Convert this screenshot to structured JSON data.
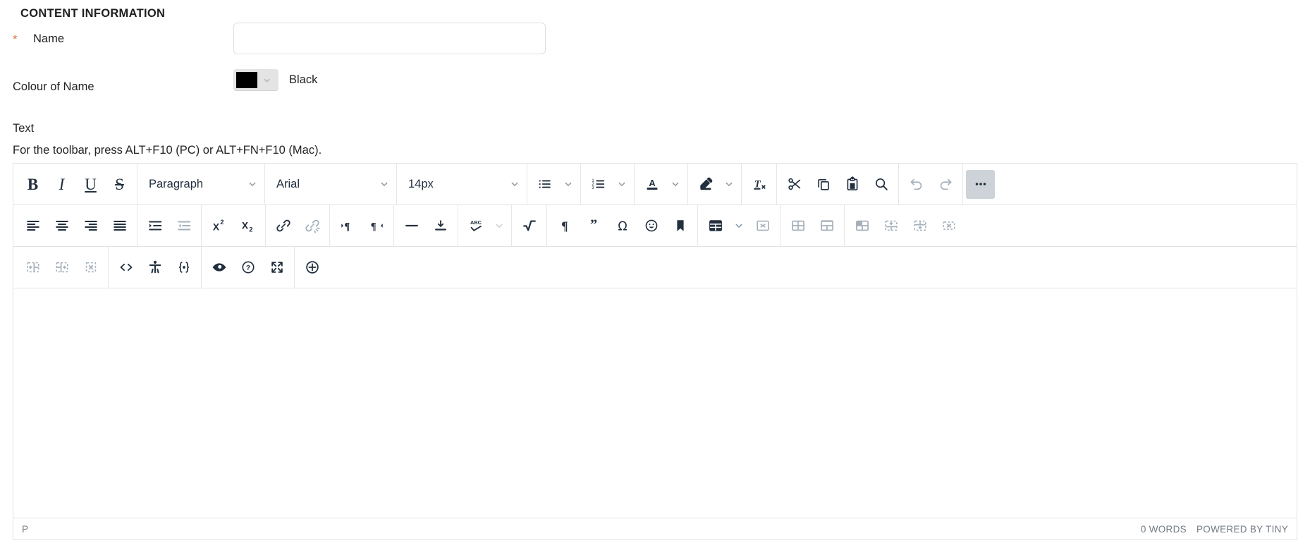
{
  "form": {
    "section_title": "CONTENT INFORMATION",
    "name_field": {
      "label": "Name",
      "required_marker": "*",
      "value": "",
      "placeholder": ""
    },
    "colour_field": {
      "label": "Colour of Name",
      "selected_colour_name": "Black",
      "selected_colour_hex": "#000000",
      "chevron_icon": "chevron-down-icon"
    },
    "text_field": {
      "label": "Text",
      "hint": "For the toolbar, press ALT+F10 (PC) or ALT+FN+F10 (Mac)."
    }
  },
  "editor": {
    "toolbar_rows": [
      {
        "groups": [
          {
            "items": [
              {
                "name": "bold-button",
                "icon": "bold-icon",
                "label": "B",
                "disabled": false
              },
              {
                "name": "italic-button",
                "icon": "italic-icon",
                "label": "I",
                "disabled": false
              },
              {
                "name": "underline-button",
                "icon": "underline-icon",
                "label": "U",
                "disabled": false
              },
              {
                "name": "strikethrough-button",
                "icon": "strikethrough-icon",
                "label": "S",
                "disabled": false
              }
            ]
          },
          {
            "items": [
              {
                "name": "block-format-select",
                "icon": "chevron-down-icon",
                "label": "Paragraph",
                "type": "select",
                "width": "para"
              }
            ]
          },
          {
            "items": [
              {
                "name": "font-family-select",
                "icon": "chevron-down-icon",
                "label": "Arial",
                "type": "select",
                "width": "font"
              }
            ]
          },
          {
            "items": [
              {
                "name": "font-size-select",
                "icon": "chevron-down-icon",
                "label": "14px",
                "type": "select",
                "width": "size"
              }
            ]
          },
          {
            "items": [
              {
                "name": "bullet-list-button",
                "icon": "bullet-list-icon",
                "label": "",
                "split": true
              }
            ]
          },
          {
            "items": [
              {
                "name": "numbered-list-button",
                "icon": "numbered-list-icon",
                "label": "",
                "split": true
              }
            ]
          },
          {
            "items": [
              {
                "name": "text-colour-button",
                "icon": "text-colour-icon",
                "label": "A",
                "split": true
              }
            ]
          },
          {
            "items": [
              {
                "name": "highlight-colour-button",
                "icon": "highlighter-icon",
                "label": "",
                "split": true
              }
            ]
          },
          {
            "items": [
              {
                "name": "remove-format-button",
                "icon": "remove-format-icon",
                "label": "",
                "disabled": false
              }
            ]
          },
          {
            "items": [
              {
                "name": "cut-button",
                "icon": "scissors-icon",
                "label": "",
                "disabled": false
              },
              {
                "name": "copy-button",
                "icon": "copy-icon",
                "label": "",
                "disabled": false
              },
              {
                "name": "paste-button",
                "icon": "clipboard-icon",
                "label": "",
                "disabled": false
              },
              {
                "name": "search-replace-button",
                "icon": "search-icon",
                "label": "",
                "disabled": false
              }
            ]
          },
          {
            "items": [
              {
                "name": "undo-button",
                "icon": "undo-icon",
                "label": "",
                "disabled": true
              },
              {
                "name": "redo-button",
                "icon": "redo-icon",
                "label": "",
                "disabled": true
              }
            ]
          },
          {
            "items": [
              {
                "name": "more-toolbar-button",
                "icon": "ellipsis-icon",
                "label": "",
                "disabled": false,
                "active": true
              }
            ]
          }
        ]
      },
      {
        "groups": [
          {
            "items": [
              {
                "name": "align-left-button",
                "icon": "align-left-icon",
                "label": "",
                "disabled": false
              },
              {
                "name": "align-center-button",
                "icon": "align-center-icon",
                "label": "",
                "disabled": false
              },
              {
                "name": "align-right-button",
                "icon": "align-right-icon",
                "label": "",
                "disabled": false
              },
              {
                "name": "align-justify-button",
                "icon": "align-justify-icon",
                "label": "",
                "disabled": false
              }
            ]
          },
          {
            "items": [
              {
                "name": "indent-button",
                "icon": "indent-icon",
                "label": "",
                "disabled": false
              },
              {
                "name": "outdent-button",
                "icon": "outdent-icon",
                "label": "",
                "disabled": true
              }
            ]
          },
          {
            "items": [
              {
                "name": "superscript-button",
                "icon": "superscript-icon",
                "label": "",
                "disabled": false
              },
              {
                "name": "subscript-button",
                "icon": "subscript-icon",
                "label": "",
                "disabled": false
              }
            ]
          },
          {
            "items": [
              {
                "name": "insert-link-button",
                "icon": "link-icon",
                "label": "",
                "disabled": false
              },
              {
                "name": "unlink-button",
                "icon": "unlink-icon",
                "label": "",
                "disabled": true
              }
            ]
          },
          {
            "items": [
              {
                "name": "ltr-button",
                "icon": "ltr-icon",
                "label": "",
                "disabled": false
              },
              {
                "name": "rtl-button",
                "icon": "rtl-icon",
                "label": "",
                "disabled": false
              }
            ]
          },
          {
            "items": [
              {
                "name": "horizontal-rule-button",
                "icon": "horizontal-rule-icon",
                "label": "",
                "disabled": false
              },
              {
                "name": "page-break-button",
                "icon": "page-break-icon",
                "label": "",
                "disabled": false
              }
            ]
          },
          {
            "items": [
              {
                "name": "spellcheck-button",
                "icon": "spellcheck-icon",
                "label": "",
                "split": true,
                "split_disabled": true
              }
            ]
          },
          {
            "items": [
              {
                "name": "math-equation-button",
                "icon": "square-root-icon",
                "label": "",
                "disabled": false
              }
            ]
          },
          {
            "items": [
              {
                "name": "show-blocks-button",
                "icon": "pilcrow-icon",
                "label": "",
                "disabled": false
              },
              {
                "name": "blockquote-button",
                "icon": "quote-icon",
                "label": "",
                "disabled": false
              },
              {
                "name": "special-character-button",
                "icon": "omega-icon",
                "label": "",
                "disabled": false
              },
              {
                "name": "emoticon-button",
                "icon": "emoji-icon",
                "label": "",
                "disabled": false
              },
              {
                "name": "anchor-button",
                "icon": "bookmark-icon",
                "label": "",
                "disabled": false
              }
            ]
          },
          {
            "items": [
              {
                "name": "insert-table-button",
                "icon": "table-icon",
                "label": "",
                "split": true
              },
              {
                "name": "delete-table-button",
                "icon": "delete-table-icon",
                "label": "",
                "disabled": true
              }
            ]
          },
          {
            "items": [
              {
                "name": "table-cell-properties-button",
                "icon": "cell-properties-icon",
                "label": "",
                "disabled": true
              },
              {
                "name": "merge-cells-button",
                "icon": "merge-cells-icon",
                "label": "",
                "disabled": true
              }
            ]
          },
          {
            "items": [
              {
                "name": "table-row-properties-button",
                "icon": "row-properties-icon",
                "label": "",
                "disabled": true
              },
              {
                "name": "insert-row-above-button",
                "icon": "row-insert-above-icon",
                "label": "",
                "disabled": true
              },
              {
                "name": "insert-row-below-button",
                "icon": "row-insert-below-icon",
                "label": "",
                "disabled": true
              },
              {
                "name": "delete-row-button",
                "icon": "delete-row-icon",
                "label": "",
                "disabled": true
              }
            ]
          }
        ]
      },
      {
        "groups": [
          {
            "items": [
              {
                "name": "insert-column-before-button",
                "icon": "column-insert-before-icon",
                "label": "",
                "disabled": true
              },
              {
                "name": "insert-column-after-button",
                "icon": "column-insert-after-icon",
                "label": "",
                "disabled": true
              },
              {
                "name": "delete-column-button",
                "icon": "delete-column-icon",
                "label": "",
                "disabled": true
              }
            ]
          },
          {
            "items": [
              {
                "name": "source-code-button",
                "icon": "source-code-icon",
                "label": "",
                "disabled": false
              },
              {
                "name": "accessibility-check-button",
                "icon": "accessibility-icon",
                "label": "",
                "disabled": false
              },
              {
                "name": "code-sample-button",
                "icon": "code-sample-icon",
                "label": "",
                "disabled": false
              }
            ]
          },
          {
            "items": [
              {
                "name": "preview-button",
                "icon": "eye-icon",
                "label": "",
                "disabled": false
              },
              {
                "name": "help-button",
                "icon": "question-circle-icon",
                "label": "",
                "disabled": false
              },
              {
                "name": "fullscreen-button",
                "icon": "fullscreen-icon",
                "label": "",
                "disabled": false
              }
            ]
          },
          {
            "items": [
              {
                "name": "insert-media-button",
                "icon": "plus-circle-icon",
                "label": "",
                "disabled": false
              }
            ]
          }
        ]
      }
    ],
    "content": "",
    "status": {
      "element_path": "P",
      "word_count": "0 WORDS",
      "branding": "POWERED BY TINY"
    }
  },
  "colors": {
    "accent_required": "#d9733f",
    "toolbar_icon": "#222f3e",
    "toolbar_icon_disabled": "#a6b0bb",
    "border": "#e3e3e3",
    "status_text": "#737b82"
  }
}
